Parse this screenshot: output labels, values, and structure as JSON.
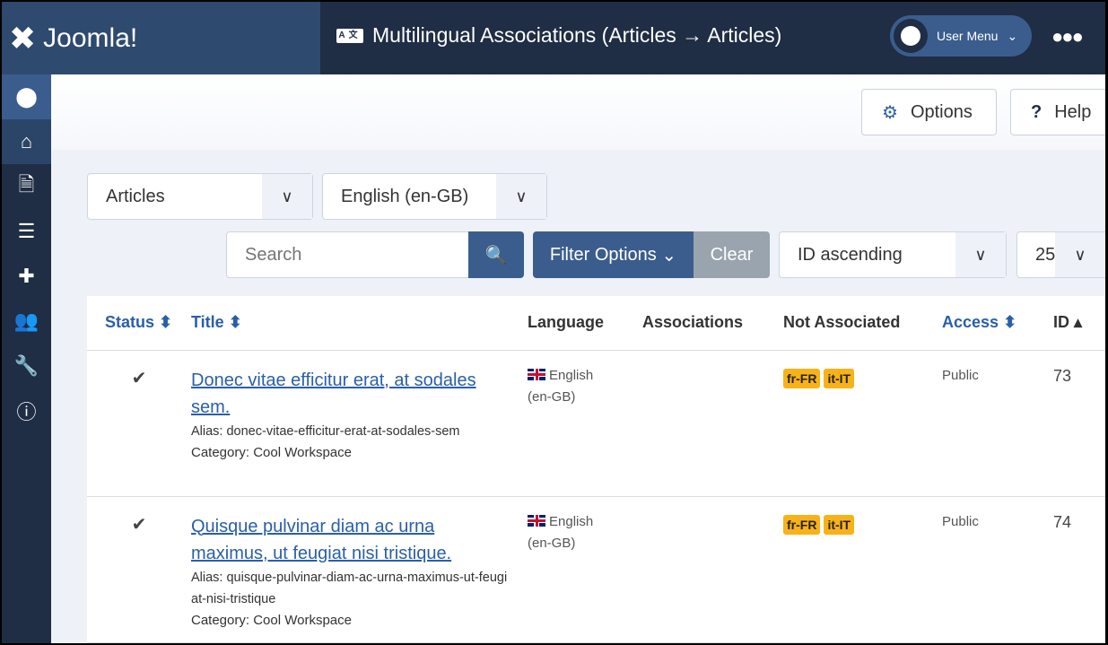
{
  "header": {
    "logo": "Joomla!",
    "title": "Multilingual Associations (Articles → Articles)",
    "user_menu": "User Menu",
    "more": "●●●"
  },
  "sidebar": {
    "items": [
      "toggle",
      "home",
      "content",
      "menu",
      "extensions",
      "users",
      "system",
      "help"
    ]
  },
  "toolbar": {
    "options": "Options",
    "help": "Help"
  },
  "filters": {
    "item_type": "Articles",
    "language": "English (en-GB)",
    "search_placeholder": "Search",
    "filter_options": "Filter Options",
    "clear": "Clear",
    "ordering": "ID ascending",
    "limit": "25"
  },
  "table": {
    "headers": {
      "status": "Status",
      "title": "Title",
      "language": "Language",
      "associations": "Associations",
      "not_associated": "Not Associated",
      "access": "Access",
      "id": "ID"
    },
    "rows": [
      {
        "status": "✔",
        "title": "Donec vitae efficitur erat, at sodales sem.",
        "alias": "Alias: donec-vitae-efficitur-erat-at-sodales-sem",
        "category": "Category: Cool Workspace",
        "language": "English (en-GB)",
        "associations": "",
        "not_associated": [
          "fr-FR",
          "it-IT"
        ],
        "access": "Public",
        "id": "73"
      },
      {
        "status": "✔",
        "title": "Quisque pulvinar diam ac urna maximus, ut feugiat nisi tristique.",
        "alias": "Alias: quisque-pulvinar-diam-ac-urna-maximus-ut-feugiat-nisi-tristique",
        "category": "Category: Cool Workspace",
        "language": "English (en-GB)",
        "associations": "",
        "not_associated": [
          "fr-FR",
          "it-IT"
        ],
        "access": "Public",
        "id": "74"
      }
    ]
  },
  "colors": {
    "header": "#1f2d45",
    "logo_bg": "#2e4a6e",
    "accent": "#3a5d8d",
    "link": "#2a5fa8",
    "badge": "#f8b218"
  }
}
